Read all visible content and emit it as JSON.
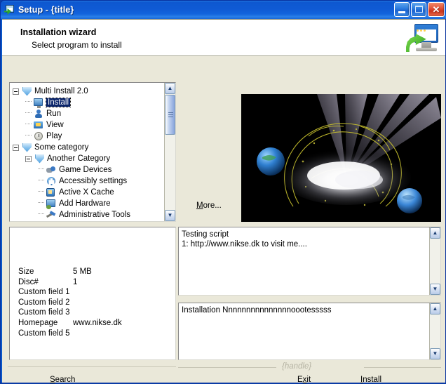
{
  "window": {
    "title_prefix": "Setup",
    "title_sep": " - ",
    "title_value": "{title}",
    "icon": "setup-monitor-icon",
    "caption_buttons": {
      "minimize": "minimize-icon",
      "maximize": "maximize-icon",
      "close": "✕"
    },
    "colors": {
      "titlebar": "#0f5ad4",
      "close": "#c7341c",
      "client_bg": "#eae8d9",
      "panel_bg": "#ffffff",
      "selection": "#0a246a",
      "frame": "#0832a0"
    }
  },
  "header": {
    "title": "Installation wizard",
    "subtitle": "Select program to install",
    "icon": "install-monitor-arrow-icon"
  },
  "tree": {
    "nodes": [
      {
        "label": "Multi Install 2.0",
        "depth": 0,
        "expander": "minus",
        "icon": "shield-icon",
        "selected": false
      },
      {
        "label": "Install",
        "depth": 1,
        "expander": "none",
        "icon": "monitor-icon",
        "selected": true
      },
      {
        "label": "Run",
        "depth": 1,
        "expander": "none",
        "icon": "person-icon",
        "selected": false
      },
      {
        "label": "View",
        "depth": 1,
        "expander": "none",
        "icon": "folder-search-icon",
        "selected": false
      },
      {
        "label": "Play",
        "depth": 1,
        "expander": "none",
        "icon": "clock-icon",
        "selected": false
      },
      {
        "label": "Some category",
        "depth": 0,
        "expander": "minus",
        "icon": "shield-icon",
        "selected": false
      },
      {
        "label": "Another Category",
        "depth": 1,
        "expander": "minus",
        "icon": "shield-icon",
        "selected": false
      },
      {
        "label": "Game Devices",
        "depth": 2,
        "expander": "none",
        "icon": "gamepad-icon",
        "selected": false
      },
      {
        "label": "Accessibly settings",
        "depth": 2,
        "expander": "none",
        "icon": "accessibility-icon",
        "selected": false
      },
      {
        "label": "Active X Cache",
        "depth": 2,
        "expander": "none",
        "icon": "activex-icon",
        "selected": false
      },
      {
        "label": "Add Hardware",
        "depth": 2,
        "expander": "none",
        "icon": "add-hardware-icon",
        "selected": false
      },
      {
        "label": "Administrative Tools",
        "depth": 2,
        "expander": "none",
        "icon": "admin-tools-icon",
        "selected": false
      }
    ],
    "scrollbar": {
      "up_glyph": "▲",
      "down_glyph": "▼",
      "grip": "scrollbar-grip-icon"
    }
  },
  "details": {
    "rows": [
      {
        "key": "Size",
        "value": "5 MB"
      },
      {
        "key": "Disc#",
        "value": "1"
      },
      {
        "key": "Custom field 1",
        "value": ""
      },
      {
        "key": "Custom field 2",
        "value": ""
      },
      {
        "key": "Custom field 3",
        "value": ""
      },
      {
        "key": "Homepage",
        "value": "www.nikse.dk"
      },
      {
        "key": "Custom field 5",
        "value": ""
      }
    ]
  },
  "preview": {
    "more_label_accel": "M",
    "more_label_rest": "ore...",
    "image_alt": "space-explosion-preview"
  },
  "script_box": {
    "text": "Testing script\n1: http://www.nikse.dk to visit me....",
    "scrollbar": {
      "up_glyph": "▲",
      "down_glyph": "▼"
    }
  },
  "notes_box": {
    "text": "Installation Nnnnnnnnnnnnnnnoootesssss",
    "scrollbar": {
      "up_glyph": "▲",
      "down_glyph": "▼"
    }
  },
  "handle_group": {
    "label": "{handle}"
  },
  "buttons": {
    "search": {
      "accel": "S",
      "rest": "earch"
    },
    "exit": {
      "pre": "E",
      "accel": "x",
      "rest": "it"
    },
    "install": {
      "accel": "I",
      "rest": "nstall"
    }
  }
}
